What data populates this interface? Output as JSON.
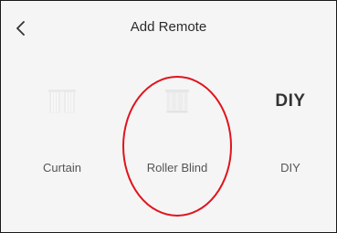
{
  "header": {
    "title": "Add Remote",
    "back_icon": "chevron-left-icon"
  },
  "options": [
    {
      "id": "curtain",
      "label": "Curtain",
      "icon": "curtain-icon"
    },
    {
      "id": "roller-blind",
      "label": "Roller Blind",
      "icon": "roller-blind-icon"
    },
    {
      "id": "diy",
      "label": "DIY",
      "icon_text": "DIY"
    }
  ],
  "annotation": {
    "shape": "ellipse",
    "color": "#e0141e",
    "target": "roller-blind"
  },
  "colors": {
    "background": "#f5f5f5",
    "text_primary": "#2b2b2b",
    "text_secondary": "#555555",
    "icon_light": "#e4e4e4"
  }
}
